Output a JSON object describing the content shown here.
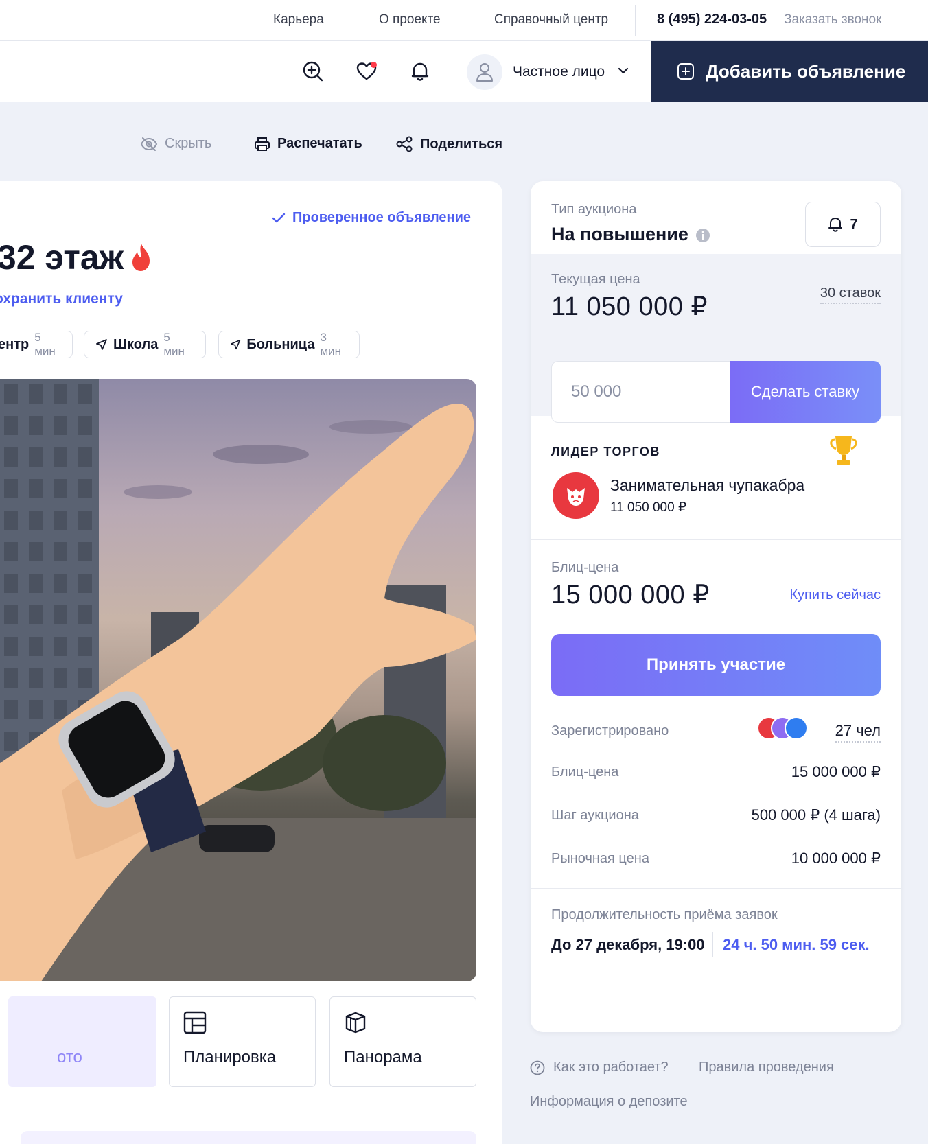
{
  "topbar": {
    "links": [
      "Карьера",
      "О проекте",
      "Справочный центр"
    ],
    "phone": "8 (495) 224-03-05",
    "callback": "Заказать звонок"
  },
  "header": {
    "user_type": "Частное лицо",
    "add_listing": "Добавить объявление"
  },
  "actions": {
    "hide": "Скрыть",
    "print": "Распечатать",
    "share": "Поделиться"
  },
  "listing": {
    "verified": "Проверенное объявление",
    "title": "/32 этаж",
    "save_to_client": "охранить клиенту",
    "chips": [
      {
        "name": "ентр",
        "time": "5 мин"
      },
      {
        "name": "Школа",
        "time": "5 мин"
      },
      {
        "name": "Больница",
        "time": "3 мин"
      }
    ],
    "tiles": {
      "photo": "ото",
      "layout": "Планировка",
      "panorama": "Панорама"
    }
  },
  "auction": {
    "type_label": "Тип аукциона",
    "type_value": "На повышение",
    "subscribers": "7",
    "current_price_label": "Текущая цена",
    "current_price": "11 050 000 ₽",
    "bids_count": "30 ставок",
    "bid_input_value": "50 000",
    "bid_button": "Сделать ставку",
    "leader_label": "ЛИДЕР ТОРГОВ",
    "leader_name": "Занимательная чупакабра",
    "leader_price": "11 050 000 ₽",
    "blitz_label": "Блиц-цена",
    "blitz_price": "15 000 000 ₽",
    "buy_now": "Купить сейчас",
    "join_button": "Принять участие",
    "details": [
      {
        "label": "Зарегистрировано",
        "value": "27 чел"
      },
      {
        "label": "Блиц-цена",
        "value": "15 000 000 ₽"
      },
      {
        "label": "Шаг аукциона",
        "value": "500 000 ₽ (4 шага)"
      },
      {
        "label": "Рыночная цена",
        "value": "10 000 000 ₽"
      }
    ],
    "duration_label": "Продолжительность приёма заявок",
    "deadline": "До 27 декабря, 19:00",
    "timer": "24 ч. 50 мин. 59 сек."
  },
  "footer_links": {
    "how_it_works": "Как это работает?",
    "rules": "Правила проведения",
    "deposit": "Информация о депозите"
  },
  "colors": {
    "accent": "#4d5df0",
    "navy": "#1f2c4d",
    "fire": "#f0403a",
    "gold": "#f6b71c"
  }
}
